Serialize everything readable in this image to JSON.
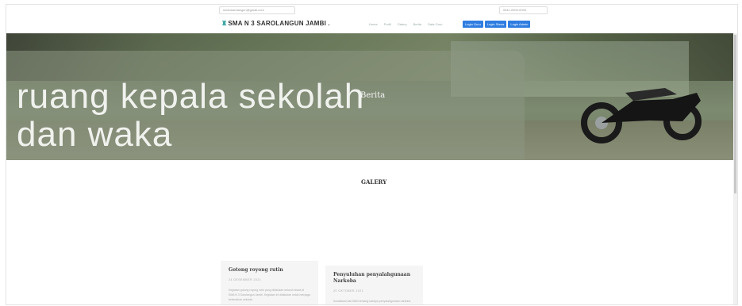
{
  "topbar": {
    "email": "smansarolangun@gmail.com",
    "phone": "0811-0000-0000"
  },
  "nav": {
    "brand": "SMA N 3 SAROLANGUN JAMBI .",
    "menu": [
      "Home",
      "Profil",
      "Galery",
      "Berita",
      "Data Guru"
    ],
    "logins": [
      "Login Guru",
      "Login Siswa",
      "Login Admin"
    ]
  },
  "hero": {
    "title_line1": "ruang kepala sekolah",
    "title_line2": "dan waka",
    "label": "Berita"
  },
  "galery": {
    "heading": "GALERY"
  },
  "cards": [
    {
      "title": "Gotong royong rutin",
      "date": "24 DESEMBER 2021",
      "text": "Kegiatan gotong royong rutin yang dilakukan seluruh siswa di SMA N 3 Sarolangun Jambi. Kegiatan ini dilakukan untuk menjaga kebersihan sekolah."
    },
    {
      "title": "Penyuluhan penyalahgunaan Narkoba",
      "date": "20 OKTOBER 2021",
      "text": "Sosialisasi dari BNN tentang bahaya penyalahgunaan narkoba bagi siswa."
    }
  ]
}
